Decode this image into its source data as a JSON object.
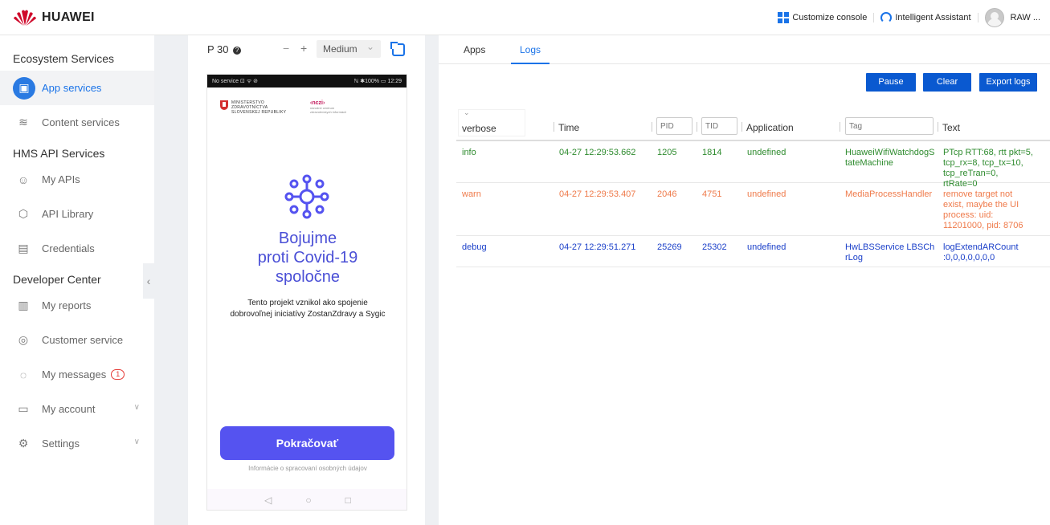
{
  "header": {
    "brand": "HUAWEI",
    "customize": "Customize console",
    "assistant": "Intelligent Assistant",
    "user": "RAW ..."
  },
  "sidebar": {
    "groups": [
      {
        "title": "Ecosystem Services",
        "items": [
          "App services",
          "Content services"
        ]
      },
      {
        "title": "HMS API Services",
        "items": [
          "My APIs",
          "API Library",
          "Credentials"
        ]
      },
      {
        "title": "Developer Center",
        "items": [
          "My reports",
          "Customer service",
          "My messages",
          "My account",
          "Settings"
        ]
      }
    ],
    "messages_badge": "1",
    "active_item": "App services"
  },
  "device": {
    "model": "P 30",
    "minus": "−",
    "plus": "+",
    "size": "Medium",
    "status_left": "No service ⊡ ᯤ ⊘",
    "status_right": "ℕ ✱100% ▭ 12:29",
    "ministry_lines": [
      "MINISTERSTVO",
      "ZDRAVOTNÍCTVA",
      "SLOVENSKEJ REPUBLIKY"
    ],
    "nczi_logo": "‹nczi›",
    "nczi_sub_lines": [
      "národné centrum",
      "zdravotníckych informácií"
    ],
    "title_lines": [
      "Bojujme",
      "proti Covid-19",
      "spoločne"
    ],
    "subtitle_lines": [
      "Tento projekt vznikol ako spojenie",
      "dobrovoľnej iniciatívy ZostanZdravy a Sygic"
    ],
    "cta": "Pokračovať",
    "privacy": "Informácie o spracovaní osobných údajov",
    "nav": [
      "◁",
      "○",
      "□"
    ]
  },
  "logs": {
    "tabs": [
      "Apps",
      "Logs"
    ],
    "active_tab": "Logs",
    "buttons": {
      "pause": "Pause",
      "clear": "Clear",
      "export": "Export logs"
    },
    "level_filter": "verbose",
    "columns": {
      "time": "Time",
      "application": "Application",
      "text": "Text"
    },
    "placeholders": {
      "pid": "PID",
      "tid": "TID",
      "tag": "Tag"
    },
    "rows": [
      {
        "level": "info",
        "time": "04-27 12:29:53.662",
        "pid": "1205",
        "tid": "1814",
        "application": "undefined",
        "tag": "HuaweiWifiWatchdogStateMachine",
        "text": "PTcp RTT:68, rtt pkt=5, tcp_rx=8, tcp_tx=10, tcp_reTran=0, rtRate=0"
      },
      {
        "level": "warn",
        "time": "04-27 12:29:53.407",
        "pid": "2046",
        "tid": "4751",
        "application": "undefined",
        "tag": "MediaProcessHandler",
        "text": "remove target not exist, maybe the UI process: uid: 11201000, pid: 8706"
      },
      {
        "level": "debug",
        "time": "04-27 12:29:51.271",
        "pid": "25269",
        "tid": "25302",
        "application": "undefined",
        "tag": "HwLBSService LBSChrLog",
        "text": "logExtendARCount :0,0,0,0,0,0,0"
      }
    ]
  },
  "colors": {
    "accent": "#1a73e8",
    "button": "#0a59d0",
    "info": "#2e8b2e",
    "warn": "#ef7a4a",
    "debug": "#1a3fc9",
    "cta": "#5553f0"
  }
}
